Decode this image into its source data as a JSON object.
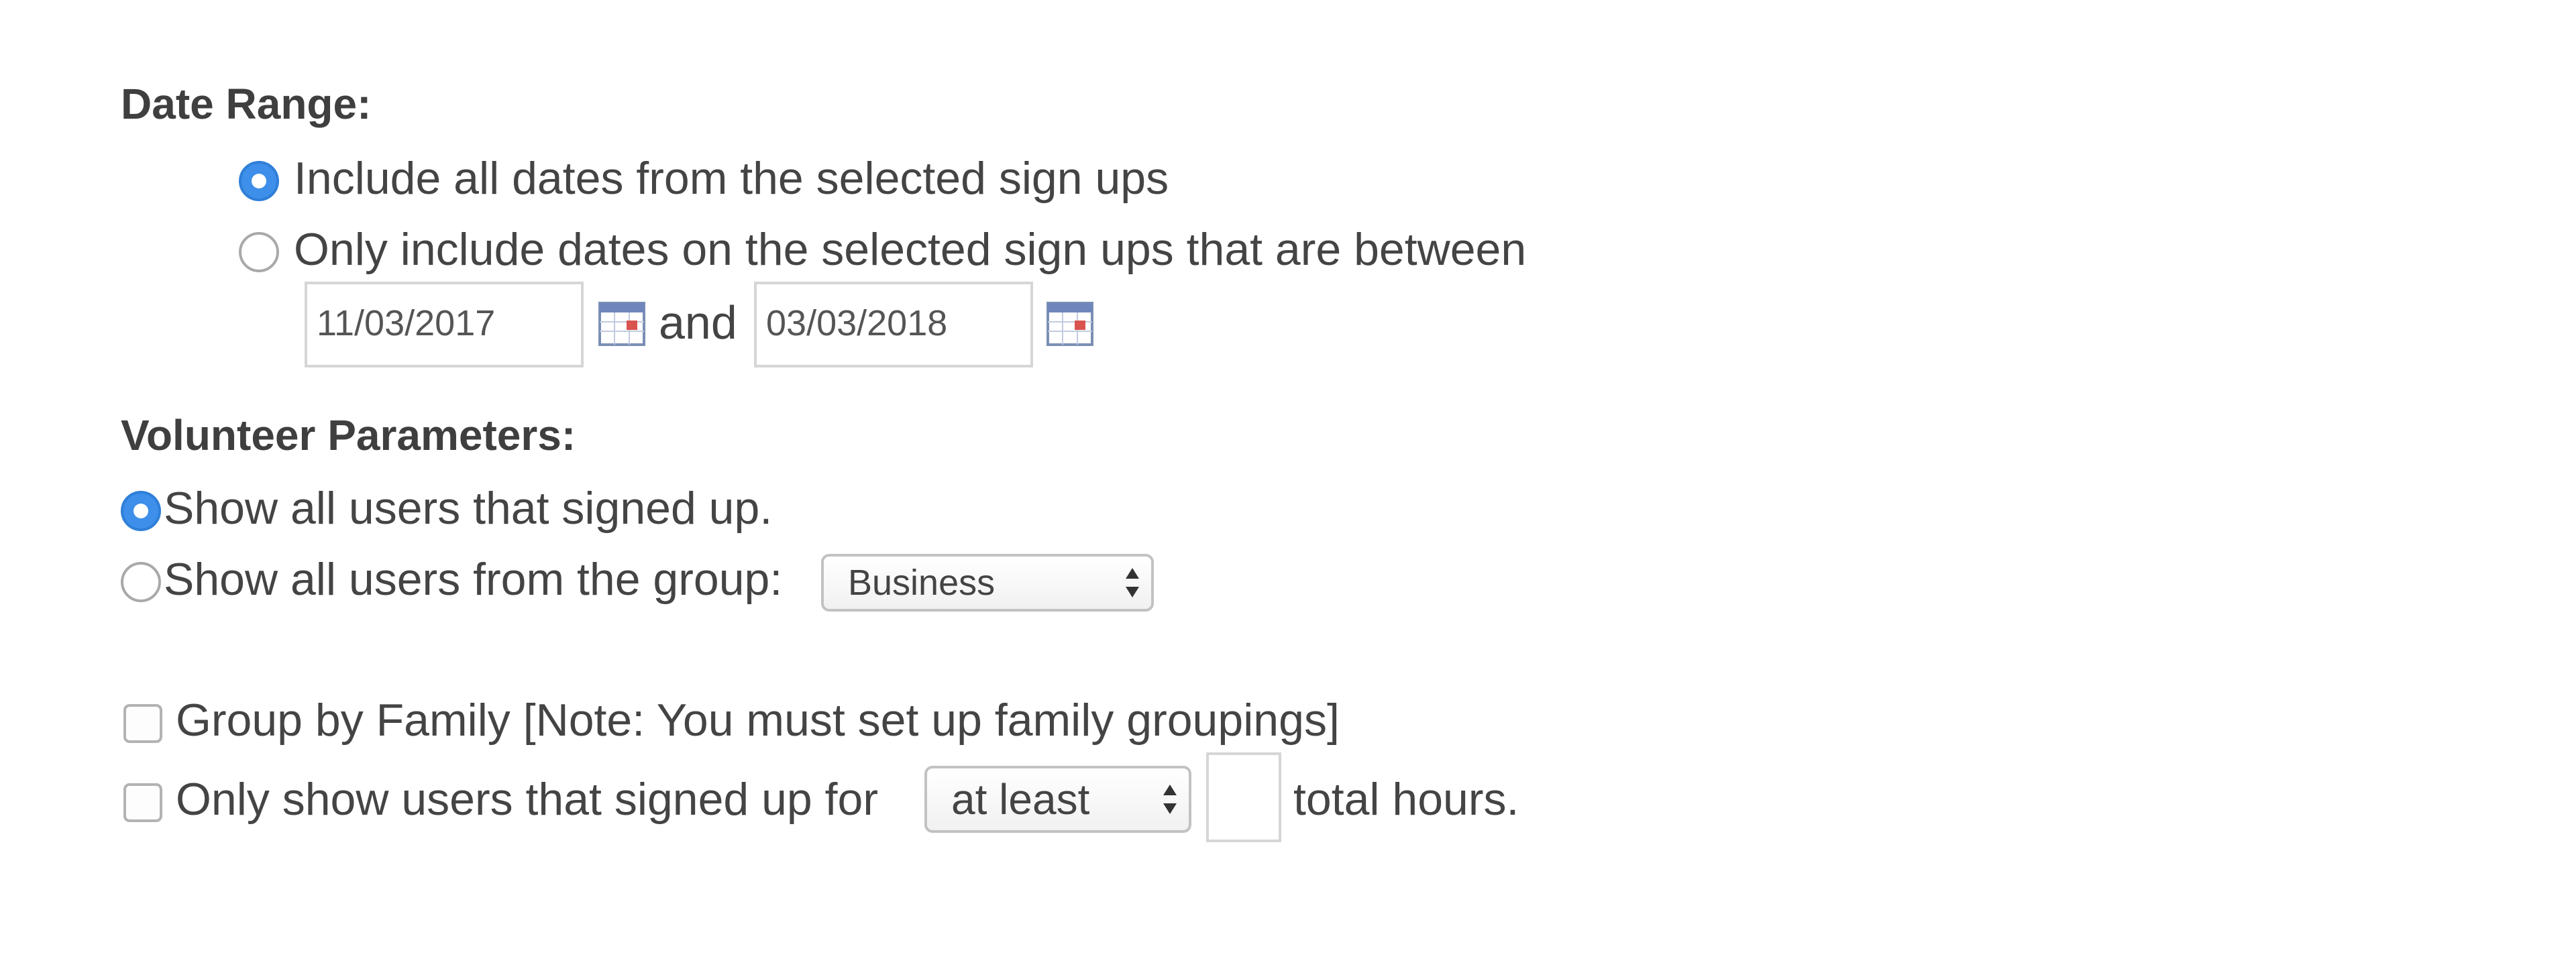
{
  "date_range": {
    "title": "Date Range:",
    "option_all": "Include all dates from the selected sign ups",
    "option_between": "Only include dates on the selected sign ups that are between",
    "start_date": "11/03/2017",
    "connector": "and",
    "end_date": "03/03/2018",
    "selected": "all"
  },
  "volunteer_parameters": {
    "title": "Volunteer Parameters:",
    "option_all_users": "Show all users that signed up.",
    "option_group": "Show all users from the group:",
    "group_select_value": "Business",
    "selected": "all_users"
  },
  "options": {
    "group_by_family": "Group by Family [Note: You must set up family groupings]",
    "group_by_family_checked": false,
    "hours_prefix": "Only show users that signed up for",
    "hours_comparator": "at least",
    "hours_value": "",
    "hours_suffix": "total hours.",
    "hours_filter_checked": false
  },
  "colors": {
    "accent": "#3d8fea",
    "text": "#444444",
    "border": "#d6d6d6"
  },
  "icons": {
    "calendar": "calendar-icon",
    "select_arrows": "updown-arrows-icon"
  }
}
